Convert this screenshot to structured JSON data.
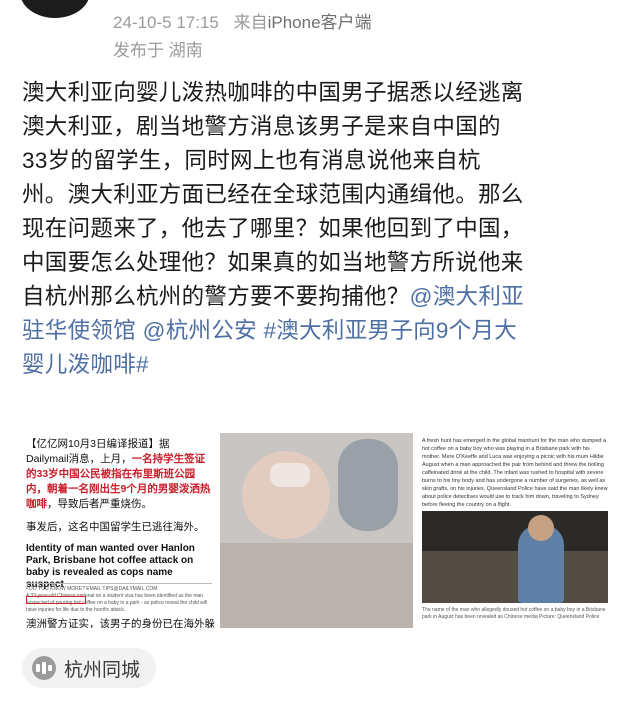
{
  "post": {
    "timestamp": "24-10-5 17:15",
    "source_prefix": "来自",
    "source": "iPhone客户端",
    "location": "发布于 湖南",
    "body": {
      "line1": "澳大利亚向婴儿泼热咖啡的中国男子据悉以经逃离",
      "line2": "澳大利亚，剧当地警方消息该男子是来自中国的",
      "line3": "33岁的留学生，同时网上也有消息说他来自杭",
      "line4": "州。澳大利亚方面已经在全球范围内通缉他。那么",
      "line5": "现在问题来了，他去了哪里？如果他回到了中国，",
      "line6": "中国要怎么处理他？如果真的如当地警方所说他来",
      "line7_text": "自杭州那么杭州的警方要不要拘捕他？",
      "mention1": "@澳大利亚",
      "mention1_cont": "驻华使领馆",
      "mention2": "@杭州公安",
      "hashtag": "#澳大利亚男子向9个月大",
      "hashtag_cont": "婴儿泼咖啡#"
    }
  },
  "media": {
    "image1": {
      "top_text_a": "【亿亿网10月3日编译报道】据Dailymail消息，上月，",
      "top_text_red": "一名持学生签证的33岁中国公民被指在布里斯班公园内，朝着一名刚出生9个月的男婴泼洒热咖啡",
      "top_text_b": "，导致后者严重烧伤。",
      "mid_text": "事发后，这名中国留学生已逃往海外。",
      "headline": "Identity of man wanted over Hanlon Park, Brisbane hot coffee attack on baby is revealed as cops name suspect",
      "byline": "• DO YOU KNOW MORE? EMAIL TIPS@DAILYMAIL.COM",
      "fine_print": "A 33-year-old Chinese national on a student visa has been identified as the man suspected of pouring hot coffee on a baby in a park - as police reveal the child will have injuries for life due to the horrific attack.",
      "bottom_text": "澳洲警方证实，该男子的身份已在海外躲"
    },
    "image3": {
      "text": "A fresh hunt has emerged in the global manhunt for the man who dumped a hot coffee on a baby boy who was playing in a Brisbane park with his mother. Mere O'Keeffe and Luca was enjoying a picnic with his mum Hildie August when a man approached the pair from behind and threw the boiling caffeinated drink at the child. The infant was rushed to hospital with severe burns to his tiny body and has undergone a number of surgeries, as well as skin grafts, on his injuries. Queensland Police have said the man likely knew about police detectives would use to track him down, traveling to Sydney before fleeing the country on a flight.",
      "caption": "The name of the man who allegedly doused hot coffee on a baby boy in a Brisbane park in August has been revealed as Chinese media Picture: Queensland Police"
    }
  },
  "topic": {
    "icon": "city-buildings-icon",
    "label": "杭州同城"
  },
  "colors": {
    "link": "#4e6fa3",
    "meta": "#9a9a9a",
    "highlight_red": "#c8202c"
  }
}
